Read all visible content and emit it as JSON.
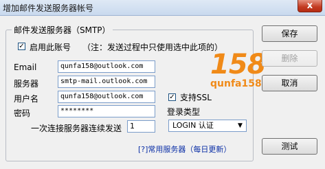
{
  "window": {
    "title": "增加邮件发送服务器帐号",
    "close_glyph": "x"
  },
  "group": {
    "title": "邮件发送服务器（SMTP）",
    "enable": {
      "label": "启用此账号",
      "checked": true
    },
    "note": "（注：发送过程中只使用选中此项的）",
    "fields": {
      "email": {
        "label": "Email",
        "value": "qunfa158@outlook.com"
      },
      "server": {
        "label": "服务器",
        "value": "smtp-mail.outlook.com"
      },
      "username": {
        "label": "用户名",
        "value": "qunfa158@outlook.com"
      },
      "password": {
        "label": "密码",
        "value": "********"
      },
      "send_count": {
        "label": "一次连接服务器连续发送",
        "value": "1"
      }
    },
    "ssl": {
      "label": "支持SSL",
      "checked": true
    },
    "login_type": {
      "label": "登录类型",
      "selected": "LOGIN 认证"
    },
    "common_servers_link": "[?]常用服务器（每日更新）"
  },
  "logo": {
    "number": "158",
    "text": "qunfa158",
    "color": "#f08a18"
  },
  "buttons": {
    "save": "保存",
    "delete": "删除",
    "cancel": "取消",
    "test": "测试"
  }
}
